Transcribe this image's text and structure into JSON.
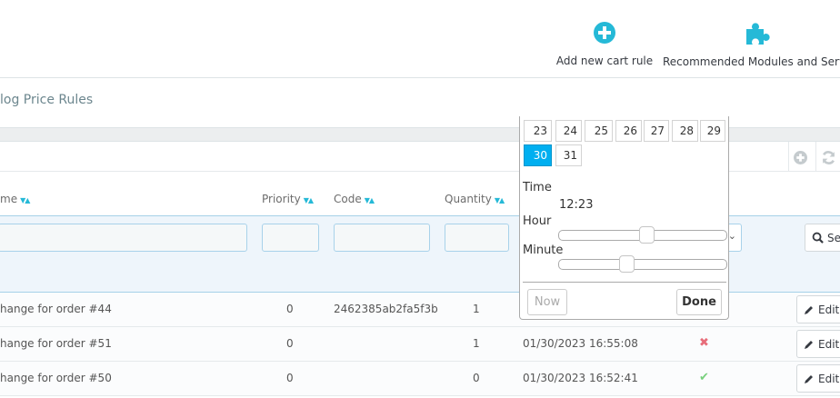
{
  "toolbar": {
    "add_cart_rule": {
      "label": "Add new cart rule",
      "icon": "plus-circle-icon"
    },
    "recommended": {
      "label": "Recommended Modules and Servic",
      "icon": "puzzle-icon"
    },
    "accent": "#25b9d7"
  },
  "breadcrumb": {
    "tab": "log Price Rules"
  },
  "list_tools": {
    "add_icon": "plus-circle-icon",
    "refresh_icon": "refresh-icon"
  },
  "columns": {
    "name": "me",
    "priority": "Priority",
    "code": "Code",
    "quantity": "Quantity",
    "sort_glyph": "▼▲"
  },
  "filters": {
    "search_label": "Se"
  },
  "rows": [
    {
      "name": "hange for order #44",
      "priority": "0",
      "code": "2462385ab2fa5f3b",
      "quantity": "1",
      "date": "",
      "status": "",
      "edit": "Edit"
    },
    {
      "name": "hange for order #51",
      "priority": "0",
      "code": "",
      "quantity": "1",
      "date": "01/30/2023 16:55:08",
      "status": "disabled",
      "status_glyph": "✖",
      "edit": "Edit"
    },
    {
      "name": "hange for order #50",
      "priority": "0",
      "code": "",
      "quantity": "0",
      "date": "01/30/2023 16:52:41",
      "status": "enabled",
      "status_glyph": "✔",
      "edit": "Edit"
    }
  ],
  "datepicker": {
    "days_row1": [
      "23",
      "24",
      "25",
      "26",
      "27",
      "28",
      "29"
    ],
    "days_row2": [
      "30",
      "31"
    ],
    "selected_day": "30",
    "time_label": "Time",
    "time_value": "12:23",
    "hour_label": "Hour",
    "minute_label": "Minute",
    "hour": 12,
    "minute": 23,
    "now_label": "Now",
    "done_label": "Done",
    "selected_color": "#00aff0"
  }
}
